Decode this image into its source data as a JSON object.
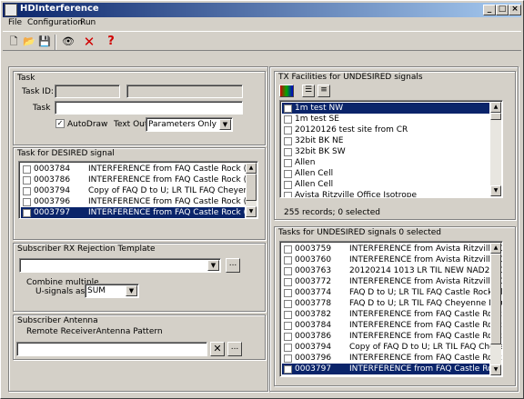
{
  "window": {
    "title": "HDInterference"
  },
  "menu": [
    "File",
    "Configuration",
    "Run"
  ],
  "toolbar": {
    "icons": [
      "new-icon",
      "open-icon",
      "save-icon",
      "view-icon",
      "delete-icon",
      "help-icon"
    ],
    "glyphs": [
      "🗋",
      "📂",
      "💾",
      "👁",
      "✕",
      "?"
    ]
  },
  "task": {
    "group_label": "Task",
    "id_label": "Task ID:",
    "task_label": "Task",
    "autodraw_label": "AutoDraw",
    "autodraw_checked": true,
    "textout_label": "Text Out:",
    "textout_value": "Parameters Only"
  },
  "desired": {
    "group_label": "Task for DESIRED signal",
    "rows": [
      {
        "id": "0003784",
        "desc": "INTERFERENCE from FAQ Castle Rock (",
        "selected": false
      },
      {
        "id": "0003786",
        "desc": "INTERFERENCE from FAQ Castle Rock (",
        "selected": false
      },
      {
        "id": "0003794",
        "desc": "Copy of FAQ D to U; LR TIL FAQ Cheyen",
        "selected": false
      },
      {
        "id": "0003796",
        "desc": "INTERFERENCE from FAQ Castle Rock (",
        "selected": false
      },
      {
        "id": "0003797",
        "desc": "INTERFERENCE from FAQ Castle Rock (",
        "selected": true
      }
    ]
  },
  "rx": {
    "group_label": "Subscriber RX Rejection Template",
    "combine_label1": "Combine multiple",
    "combine_label2": "U-signals as:",
    "combine_value": "SUM",
    "browse_label": "..."
  },
  "antenna": {
    "group_label": "Subscriber Antenna",
    "pattern_label": "Remote ReceiverAntenna Pattern",
    "clear_label": "✕",
    "browse_label": "..."
  },
  "tx": {
    "group_label": "TX Facilities for UNDESIRED signals",
    "records_text": "255 records; 0 selected",
    "rows": [
      {
        "name": "1m test NW",
        "selected": true
      },
      {
        "name": "1m test SE",
        "selected": false
      },
      {
        "name": "20120126 test site from CR",
        "selected": false
      },
      {
        "name": "32bit BK NE",
        "selected": false
      },
      {
        "name": "32bit BK SW",
        "selected": false
      },
      {
        "name": "Allen",
        "selected": false
      },
      {
        "name": "Allen Cell",
        "selected": false
      },
      {
        "name": "Allen Cell",
        "selected": false
      },
      {
        "name": "Avista Ritzville Office Isotrope",
        "selected": false
      }
    ]
  },
  "undesired": {
    "group_label": "Tasks for UNDESIRED signals 0 selected",
    "rows": [
      {
        "id": "0003759",
        "desc": "INTERFERENCE from Avista Ritzville Off",
        "selected": false
      },
      {
        "id": "0003760",
        "desc": "INTERFERENCE from Avista Ritzville Off",
        "selected": false
      },
      {
        "id": "0003763",
        "desc": "20120214 1013 LR TIL NEW NAD27 Ch",
        "selected": false
      },
      {
        "id": "0003772",
        "desc": "INTERFERENCE from Avista Ritzville Off",
        "selected": false
      },
      {
        "id": "0003774",
        "desc": "FAQ D to U; LR TIL FAQ Castle Rock Ch",
        "selected": false
      },
      {
        "id": "0003778",
        "desc": "FAQ D to U; LR TIL FAQ Cheyenne Mou",
        "selected": false
      },
      {
        "id": "0003782",
        "desc": "INTERFERENCE from FAQ Castle Rock (",
        "selected": false
      },
      {
        "id": "0003784",
        "desc": "INTERFERENCE from FAQ Castle Rock (",
        "selected": false
      },
      {
        "id": "0003786",
        "desc": "INTERFERENCE from FAQ Castle Rock (",
        "selected": false
      },
      {
        "id": "0003794",
        "desc": "Copy of FAQ D to U; LR TIL FAQ Cheyen",
        "selected": false
      },
      {
        "id": "0003796",
        "desc": "INTERFERENCE from FAQ Castle Rock (",
        "selected": false
      },
      {
        "id": "0003797",
        "desc": "INTERFERENCE from FAQ Castle Rock",
        "selected": true
      }
    ]
  }
}
